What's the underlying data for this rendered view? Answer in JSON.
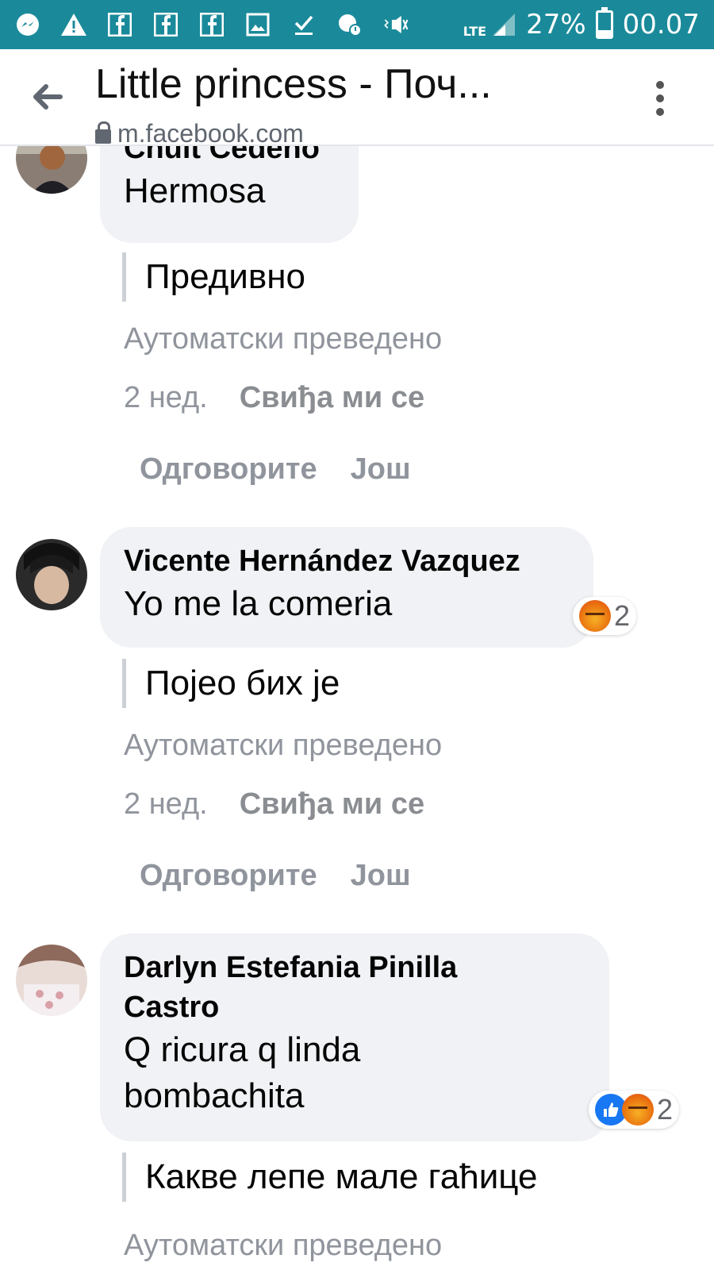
{
  "status_bar": {
    "battery": "27%",
    "time": "00.07",
    "network": "LTE",
    "icons": [
      "messenger-icon",
      "warning-icon",
      "facebook-icon",
      "facebook-icon",
      "facebook-icon",
      "image-icon",
      "download-done-icon",
      "location-icon",
      "vibrate-icon",
      "signal-icon",
      "battery-icon"
    ]
  },
  "header": {
    "title": "Little princess - Поч...",
    "url": "m.facebook.com"
  },
  "comments": [
    {
      "author": "Chuit Cedeño",
      "text": "Hermosa",
      "translation": "Предивно",
      "auto_translated": "Аутоматски преведено",
      "time": "2 нед.",
      "like_label": "Свиђа ми се",
      "reply_label": "Одговорите",
      "more_label": "Још"
    },
    {
      "author": "Vicente Hernández Vazquez",
      "text": "Yo me la comeria",
      "translation": "Појео бих је",
      "auto_translated": "Аутоматски преведено",
      "time": "2 нед.",
      "like_label": "Свиђа ми се",
      "reply_label": "Одговорите",
      "more_label": "Још",
      "reaction_count": "2"
    },
    {
      "author_line1": "Darlyn Estefania Pinilla",
      "author_line2": "Castro",
      "text_line1": "Q ricura q linda",
      "text_line2": "bombachita",
      "translation": "Какве лепе мале гаћице",
      "auto_translated": "Аутоматски преведено",
      "reaction_count": "2"
    }
  ],
  "colors": {
    "status_bar": "#1a8a9a",
    "bubble": "#f0f2f5",
    "meta_text": "#90949c",
    "like_blue": "#1877f2"
  }
}
